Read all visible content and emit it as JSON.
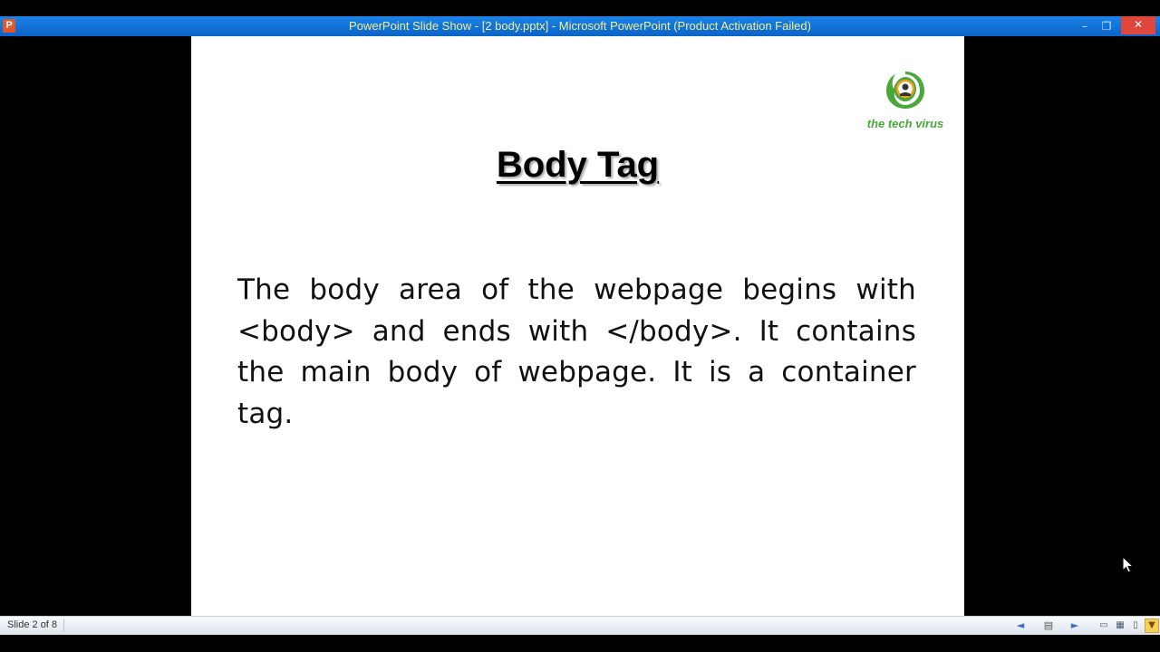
{
  "window": {
    "app_icon": "P",
    "title": "PowerPoint Slide Show - [2 body.pptx] - Microsoft PowerPoint (Product Activation Failed)",
    "controls": {
      "minimize": "–",
      "maximize": "❐",
      "close": "✕"
    }
  },
  "slide": {
    "title": "Body Tag",
    "body": "The body area of the webpage begins with <body> and ends with </body>. It contains the main body of webpage. It is a container tag.",
    "logo": {
      "text": "the tech virus",
      "colors": {
        "green": "#4aa83a",
        "orange": "#f39c1f"
      }
    }
  },
  "statusbar": {
    "slide_counter": "Slide 2 of 8",
    "buttons": {
      "previous": "◄",
      "menu": "▤",
      "next": "►",
      "normal_view": "▭",
      "slide_sorter": "▦",
      "reading_view": "▯",
      "slide_show": "▼"
    }
  },
  "colors": {
    "titlebar": "#1a84e8",
    "title_text": "#f3ef8e",
    "close": "#e0463c",
    "background": "#000000",
    "slide": "#ffffff"
  }
}
